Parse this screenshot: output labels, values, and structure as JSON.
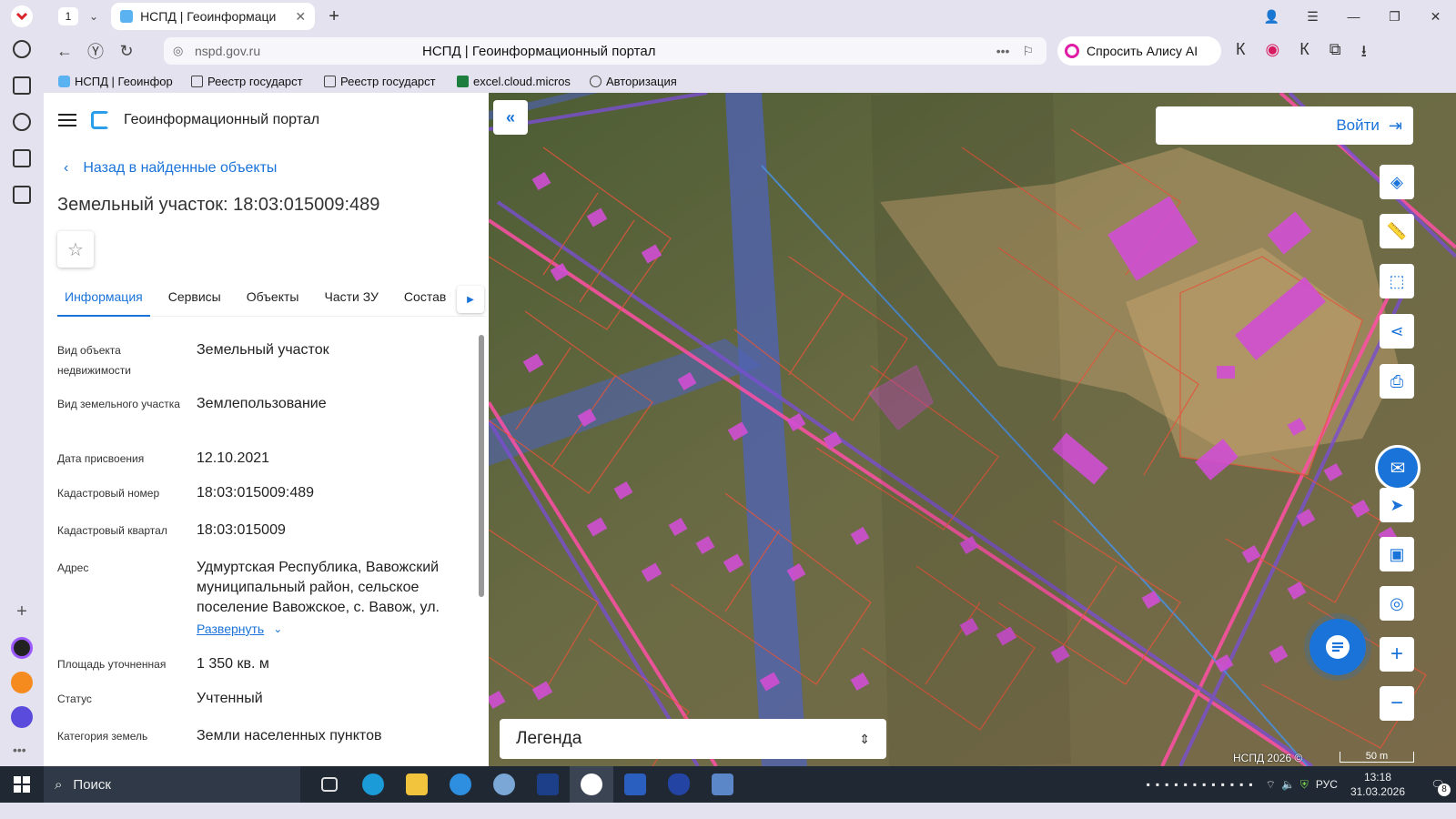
{
  "browser": {
    "tab_count": "1",
    "tab_title": "НСПД | Геоинформаци",
    "new_tab": "+",
    "domain": "nspd.gov.ru",
    "page_title": "НСПД | Геоинформационный портал",
    "ask_alice": "Спросить Алису AI",
    "bookmarks": [
      "НСПД | Геоинфор",
      "Реестр государст",
      "Реестр государст",
      "excel.cloud.micros",
      "Авторизация"
    ]
  },
  "panel": {
    "portal_title": "Геоинформационный портал",
    "back_link": "Назад в найденные объекты",
    "heading": "Земельный участок: 18:03:015009:489",
    "tabs": [
      "Информация",
      "Сервисы",
      "Объекты",
      "Части ЗУ",
      "Состав"
    ],
    "fields": [
      {
        "key": "Вид объекта недвижимости",
        "value": "Земельный участок"
      },
      {
        "key": "Вид земельного участка",
        "value": "Землепользование"
      },
      {
        "key": "Дата присвоения",
        "value": "12.10.2021"
      },
      {
        "key": "Кадастровый номер",
        "value": "18:03:015009:489"
      },
      {
        "key": "Кадастровый квартал",
        "value": "18:03:015009"
      },
      {
        "key": "Адрес",
        "value": "Удмуртская Республика, Вавожский муниципальный район, сельское поселение Вавожское, с. Вавож, ул."
      },
      {
        "key": "Площадь уточненная",
        "value": "1 350 кв. м"
      },
      {
        "key": "Статус",
        "value": "Учтенный"
      },
      {
        "key": "Категория земель",
        "value": "Земли населенных пунктов"
      }
    ],
    "expand_link": "Развернуть"
  },
  "map": {
    "login": "Войти",
    "legend": "Легенда",
    "copyright": "НСПД 2026 ©",
    "scale": "50 m"
  },
  "taskbar": {
    "search": "Поиск",
    "lang": "РУС",
    "time": "13:18",
    "date": "31.03.2026",
    "notifications": "8"
  },
  "colors": {
    "accent": "#1a73d9",
    "building": "#d14fd4",
    "parcel": "#e2553a",
    "zone": "#6a5ac8"
  }
}
